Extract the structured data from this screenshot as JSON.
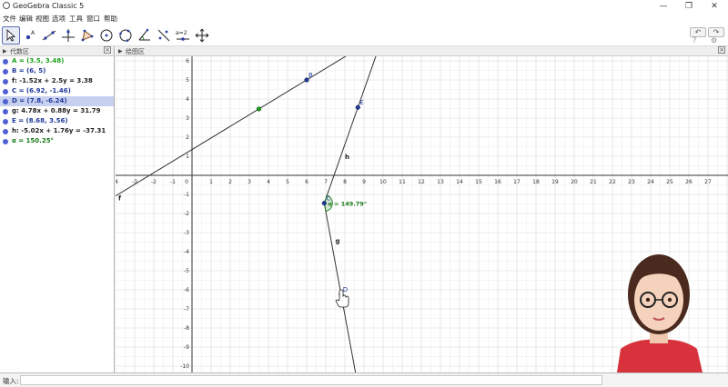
{
  "window": {
    "title": "GeoGebra Classic 5",
    "controls": {
      "minimize": "—",
      "maximize": "❐",
      "close": "✕"
    }
  },
  "menu": [
    "文件",
    "编辑",
    "视图",
    "选项",
    "工具",
    "窗口",
    "帮助"
  ],
  "toolbar": {
    "tools": [
      "move",
      "point",
      "line",
      "perpendicular-line",
      "polygon",
      "circle",
      "circle-3-points",
      "angle",
      "reflect",
      "slider",
      "move-graphics"
    ],
    "slider_tool_label": "a=2",
    "undo": "↶",
    "redo": "↷"
  },
  "algebra": {
    "title": "代数区",
    "items": [
      {
        "text": "A = (3.5, 3.48)",
        "color": "#1aa01a",
        "dot": "#5060d0",
        "selected": false
      },
      {
        "text": "B = (6, 5)",
        "color": "#1f3a9a",
        "dot": "#5060d0",
        "selected": false
      },
      {
        "text": "f: -1.52x + 2.5y = 3.38",
        "color": "#222222",
        "dot": "#5060d0",
        "selected": false
      },
      {
        "text": "C = (6.92, -1.46)",
        "color": "#1f3a9a",
        "dot": "#5060d0",
        "selected": false
      },
      {
        "text": "D = (7.8, -6.24)",
        "color": "#1f3a9a",
        "dot": "#5060d0",
        "selected": true
      },
      {
        "text": "g: 4.78x + 0.88y = 31.79",
        "color": "#222222",
        "dot": "#5060d0",
        "selected": false
      },
      {
        "text": "E = (8.68, 3.56)",
        "color": "#1f3a9a",
        "dot": "#5060d0",
        "selected": false
      },
      {
        "text": "h: -5.02x + 1.76y = -37.31",
        "color": "#222222",
        "dot": "#5060d0",
        "selected": false
      },
      {
        "text": "α = 150.25°",
        "color": "#1a7a1a",
        "dot": "#5060d0",
        "selected": false
      }
    ]
  },
  "graphics": {
    "title": "绘图区",
    "x_ticks": [
      "-4",
      "-3",
      "-2",
      "-1",
      "0",
      "1",
      "2",
      "3",
      "4",
      "5",
      "6",
      "7",
      "8",
      "9",
      "10",
      "11",
      "12",
      "13",
      "14",
      "15",
      "16",
      "17",
      "18",
      "19",
      "20",
      "21",
      "22",
      "23",
      "24",
      "25",
      "26",
      "27"
    ],
    "y_ticks": [
      "6",
      "5",
      "4",
      "3",
      "2",
      "1",
      "-1",
      "-2",
      "-3",
      "-4",
      "-5",
      "-6",
      "-7",
      "-8",
      "-9",
      "-10"
    ],
    "points": [
      {
        "name": "A",
        "x": 3.5,
        "y": 3.48,
        "label": "",
        "color": "#1aa01a"
      },
      {
        "name": "B",
        "x": 6,
        "y": 5,
        "label": "B",
        "color": "#1f3a9a"
      },
      {
        "name": "C",
        "x": 6.92,
        "y": -1.46,
        "label": "C",
        "color": "#1f3a9a"
      },
      {
        "name": "D",
        "x": 7.8,
        "y": -6.24,
        "label": "D",
        "color": "#1f3a9a"
      },
      {
        "name": "E",
        "x": 8.68,
        "y": 3.56,
        "label": "E",
        "color": "#1f3a9a"
      }
    ],
    "line_labels": {
      "f": "f",
      "g": "g",
      "h": "h"
    },
    "angle_label": "α = 149.79°"
  },
  "input": {
    "label": "输入:",
    "placeholder": ""
  },
  "colors": {
    "accent": "#5a6fb0",
    "axis": "#333333",
    "grid": "#e4e4e4",
    "angle": "#1a7a1a"
  }
}
